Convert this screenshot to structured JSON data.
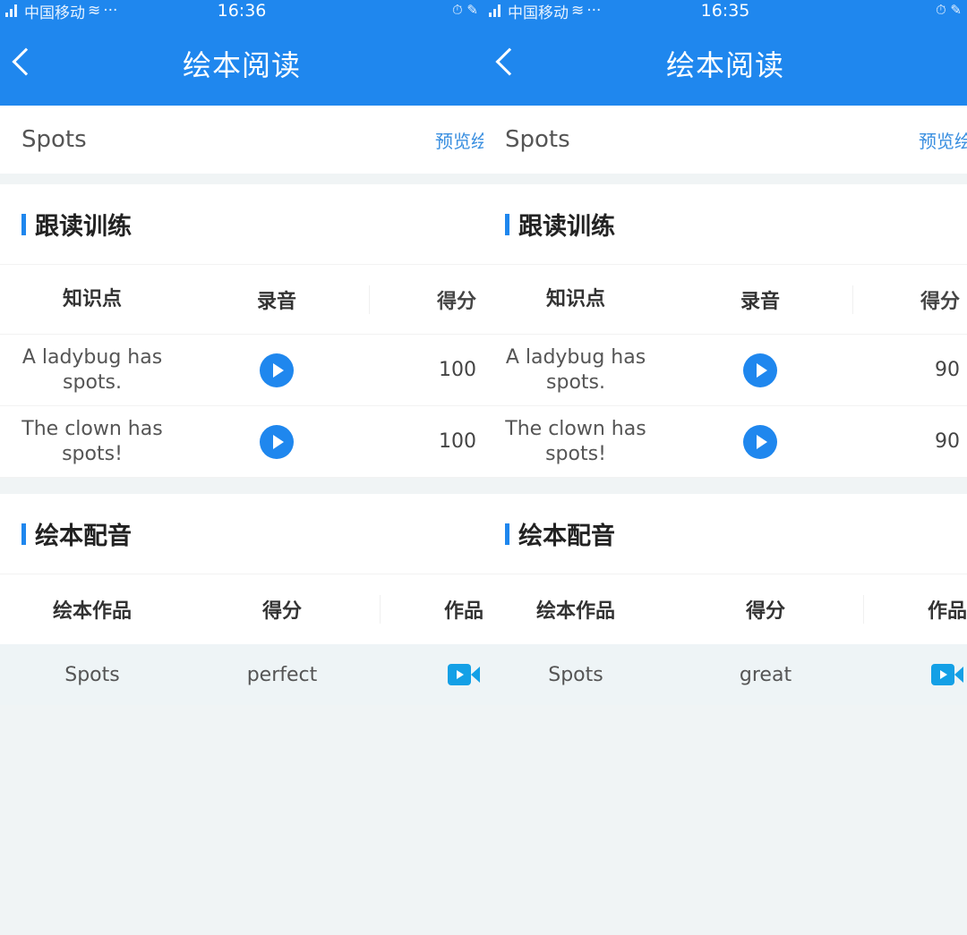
{
  "screens": [
    {
      "status": {
        "carrier": "中国移动",
        "dots": "···",
        "time": "16:36",
        "right_icons": "⏱ ✎"
      },
      "header": {
        "title": "绘本阅读"
      },
      "book": {
        "name": "Spots",
        "preview_label": "预览绘本"
      },
      "follow": {
        "title": "跟读训练",
        "columns": [
          "知识点",
          "录音",
          "得分"
        ],
        "rows": [
          {
            "text": "A ladybug has spots.",
            "score": "100"
          },
          {
            "text": "The clown has spots!",
            "score": "100"
          }
        ]
      },
      "dubbing": {
        "title": "绘本配音",
        "columns": [
          "绘本作品",
          "得分",
          "作品"
        ],
        "rows": [
          {
            "work": "Spots",
            "score": "perfect"
          }
        ]
      }
    },
    {
      "status": {
        "carrier": "中国移动",
        "dots": "···",
        "time": "16:35",
        "right_icons": "⏱ ✎"
      },
      "header": {
        "title": "绘本阅读"
      },
      "book": {
        "name": "Spots",
        "preview_label": "预览绘本"
      },
      "follow": {
        "title": "跟读训练",
        "columns": [
          "知识点",
          "录音",
          "得分"
        ],
        "rows": [
          {
            "text": "A ladybug has spots.",
            "score": "90"
          },
          {
            "text": "The clown has spots!",
            "score": "90"
          }
        ]
      },
      "dubbing": {
        "title": "绘本配音",
        "columns": [
          "绘本作品",
          "得分",
          "作品"
        ],
        "rows": [
          {
            "work": "Spots",
            "score": "great"
          }
        ]
      }
    }
  ],
  "colors": {
    "primary": "#1f87ee",
    "video_icon": "#14a0e6",
    "background": "#f0f4f5"
  },
  "icons": [
    "back-chevron-icon",
    "signal-icon",
    "wifi-icon",
    "play-icon",
    "video-icon"
  ]
}
